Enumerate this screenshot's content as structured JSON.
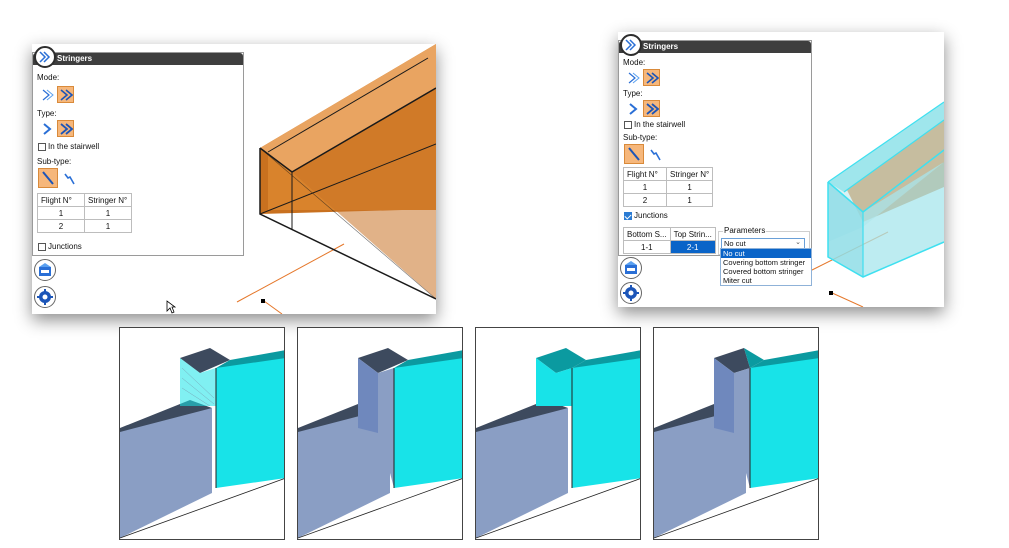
{
  "left_panel": {
    "title": "Stringers",
    "mode_label": "Mode:",
    "type_label": "Type:",
    "stairwell_label": "In the stairwell",
    "subtype_label": "Sub-type:",
    "table_headers": [
      "Flight N°",
      "Stringer N°"
    ],
    "table_rows": [
      [
        "1",
        "1"
      ],
      [
        "2",
        "1"
      ]
    ],
    "junctions_label": "Junctions"
  },
  "right_panel": {
    "title": "Stringers",
    "mode_label": "Mode:",
    "type_label": "Type:",
    "stairwell_label": "In the stairwell",
    "subtype_label": "Sub-type:",
    "table_headers": [
      "Flight N°",
      "Stringer N°"
    ],
    "table_rows": [
      [
        "1",
        "1"
      ],
      [
        "2",
        "1"
      ]
    ],
    "junctions_label": "Junctions",
    "junction_headers": [
      "Bottom S...",
      "Top Strin..."
    ],
    "junction_row": [
      "1-1",
      "2-1"
    ],
    "parameters_label": "Parameters",
    "parameters_value": "No cut",
    "parameters_options": [
      "No cut",
      "Covering bottom stringer",
      "Covered bottom stringer",
      "Miter cut"
    ]
  },
  "colors": {
    "panel_title_bg": "#3e3e3e",
    "selected_button": "#f6b77b",
    "orange_model": "#d9832c",
    "cyan_model": "#9fe6ec",
    "cyan_face": "#18e3e8",
    "blue_grey_face": "#8a9ec4",
    "dark_top": "#3d4a5e",
    "selection_blue": "#0a64c8"
  },
  "icons": [
    "stringers-logo-icon",
    "mode-icon",
    "type-icon",
    "subtype-icon",
    "view-icon",
    "gear-icon",
    "cursor-icon"
  ]
}
